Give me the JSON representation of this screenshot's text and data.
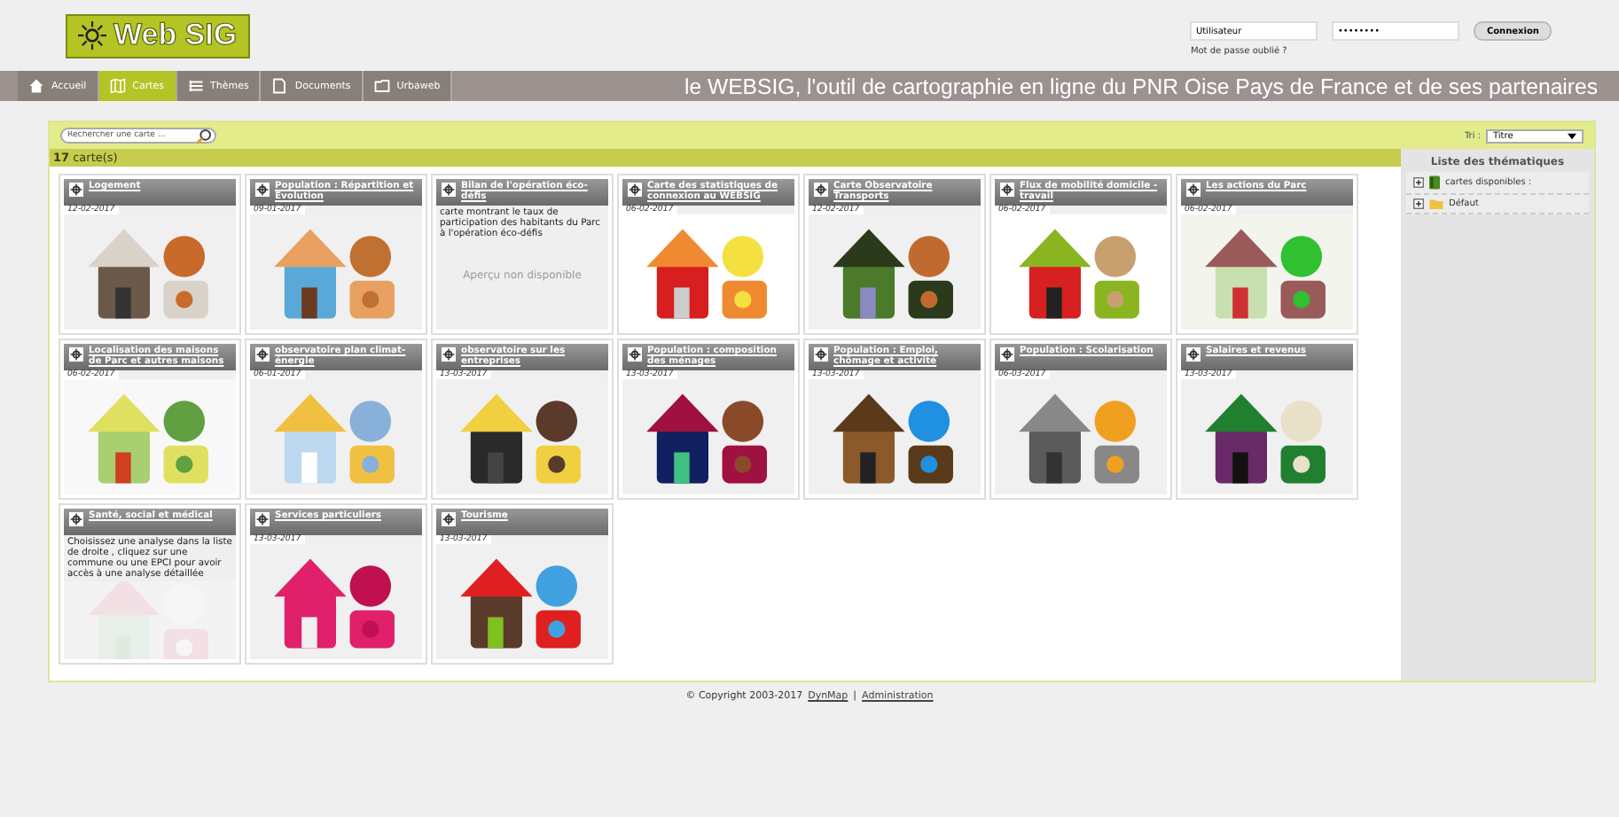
{
  "logo": {
    "text": "Web SIG"
  },
  "login": {
    "user_value": "Utilisateur",
    "password_value": "••••••••",
    "button": "Connexion",
    "forgot_link": "Mot de passe oublié ?"
  },
  "nav": {
    "items": [
      {
        "label": "Accueil",
        "selected": false
      },
      {
        "label": "Cartes",
        "selected": true
      },
      {
        "label": "Thèmes",
        "selected": false
      },
      {
        "label": "Documents",
        "selected": false
      },
      {
        "label": "Urbaweb",
        "selected": false
      }
    ],
    "tagline": "le WEBSIG, l'outil de cartographie en ligne du PNR Oise Pays de France et de ses partenaires"
  },
  "toolbar": {
    "search_placeholder": "Rechercher une carte ...",
    "sort_label": "Tri :",
    "sort_value": "Titre"
  },
  "count": {
    "number": "17",
    "label": "carte(s)"
  },
  "cards": [
    {
      "title": "Logement",
      "date": "12-02-2017",
      "kind": "picture"
    },
    {
      "title": "Population : Répartition et Evolution",
      "date": "09-01-2017",
      "kind": "picture"
    },
    {
      "title": "Bilan de l'opération éco-défis",
      "kind": "description",
      "description": "carte montrant le taux de participation des habitants du Parc à l'opération éco-défis",
      "placeholder": "Aperçu non disponible"
    },
    {
      "title": "Carte des statistiques de connexion au WEBSIG",
      "date": "06-02-2017",
      "kind": "picture"
    },
    {
      "title": "Carte Observatoire Transports",
      "date": "12-02-2017",
      "kind": "picture"
    },
    {
      "title": "Flux de mobilité domicile - travail",
      "date": "06-02-2017",
      "kind": "picture"
    },
    {
      "title": "Les actions du Parc",
      "date": "06-02-2017",
      "kind": "picture"
    },
    {
      "title": "Localisation des maisons de Parc et autres maisons",
      "date": "06-02-2017",
      "kind": "picture"
    },
    {
      "title": "observatoire plan climat-énergie",
      "date": "06-01-2017",
      "kind": "picture"
    },
    {
      "title": "observatoire sur les entreprises",
      "date": "13-03-2017",
      "kind": "picture"
    },
    {
      "title": "Population : composition des ménages",
      "date": "13-03-2017",
      "kind": "picture"
    },
    {
      "title": "Population : Emploi, chômage et activité",
      "date": "13-03-2017",
      "kind": "picture"
    },
    {
      "title": "Population : Scolarisation",
      "date": "06-03-2017",
      "kind": "picture"
    },
    {
      "title": "Salaires et revenus",
      "date": "13-03-2017",
      "kind": "picture"
    },
    {
      "title": "Santé, social et médical",
      "kind": "description_picture",
      "description": "Choisissez une analyse dans la liste de droite , cliquez sur une commune ou une EPCI pour avoir accès à une analyse détaillée"
    },
    {
      "title": "Services particuliers",
      "date": "13-03-2017",
      "kind": "picture"
    },
    {
      "title": "Tourisme",
      "date": "13-03-2017",
      "kind": "picture"
    }
  ],
  "sidebar": {
    "title": "Liste des thématiques",
    "items": [
      {
        "label": "cartes disponibles :",
        "expanded": false
      },
      {
        "label": "Défaut",
        "expanded": false
      }
    ]
  },
  "footer": {
    "copyright": "© Copyright 2003-2017",
    "links": [
      "DynMap",
      "Administration"
    ],
    "separator": "|"
  }
}
